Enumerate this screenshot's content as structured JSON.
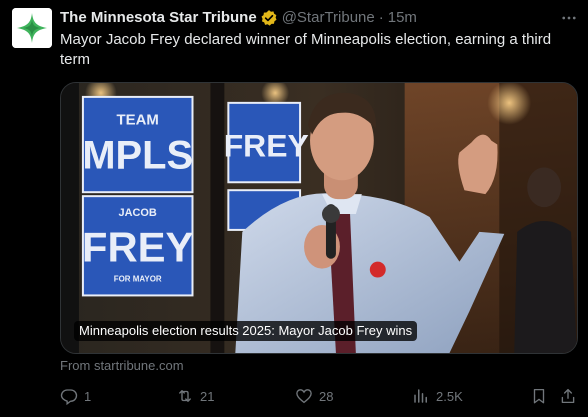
{
  "account": {
    "name": "The Minnesota Star Tribune",
    "handle": "@StarTribune",
    "separator": "·",
    "time": "15m",
    "verified_color": "#e2b719"
  },
  "tweet": {
    "text": "Mayor Jacob Frey declared winner of Minneapolis election, earning a third term"
  },
  "card": {
    "caption": "Minneapolis election results 2025: Mayor Jacob Frey wins",
    "source": "From startribune.com",
    "sign_top": {
      "line1": "TEAM",
      "line2": "MPLS"
    },
    "sign_bottom": {
      "line1": "JACOB",
      "line2": "FREY",
      "line3": "FOR MAYOR"
    },
    "sign_right": {
      "line1": "FREY"
    }
  },
  "actions": {
    "replies": "1",
    "reposts": "21",
    "likes": "28",
    "views": "2.5K"
  },
  "colors": {
    "background": "#000000",
    "text": "#e7e9ea",
    "muted": "#71767b",
    "sign_blue": "#2a57b8",
    "logo_green": "#3fb45c"
  }
}
